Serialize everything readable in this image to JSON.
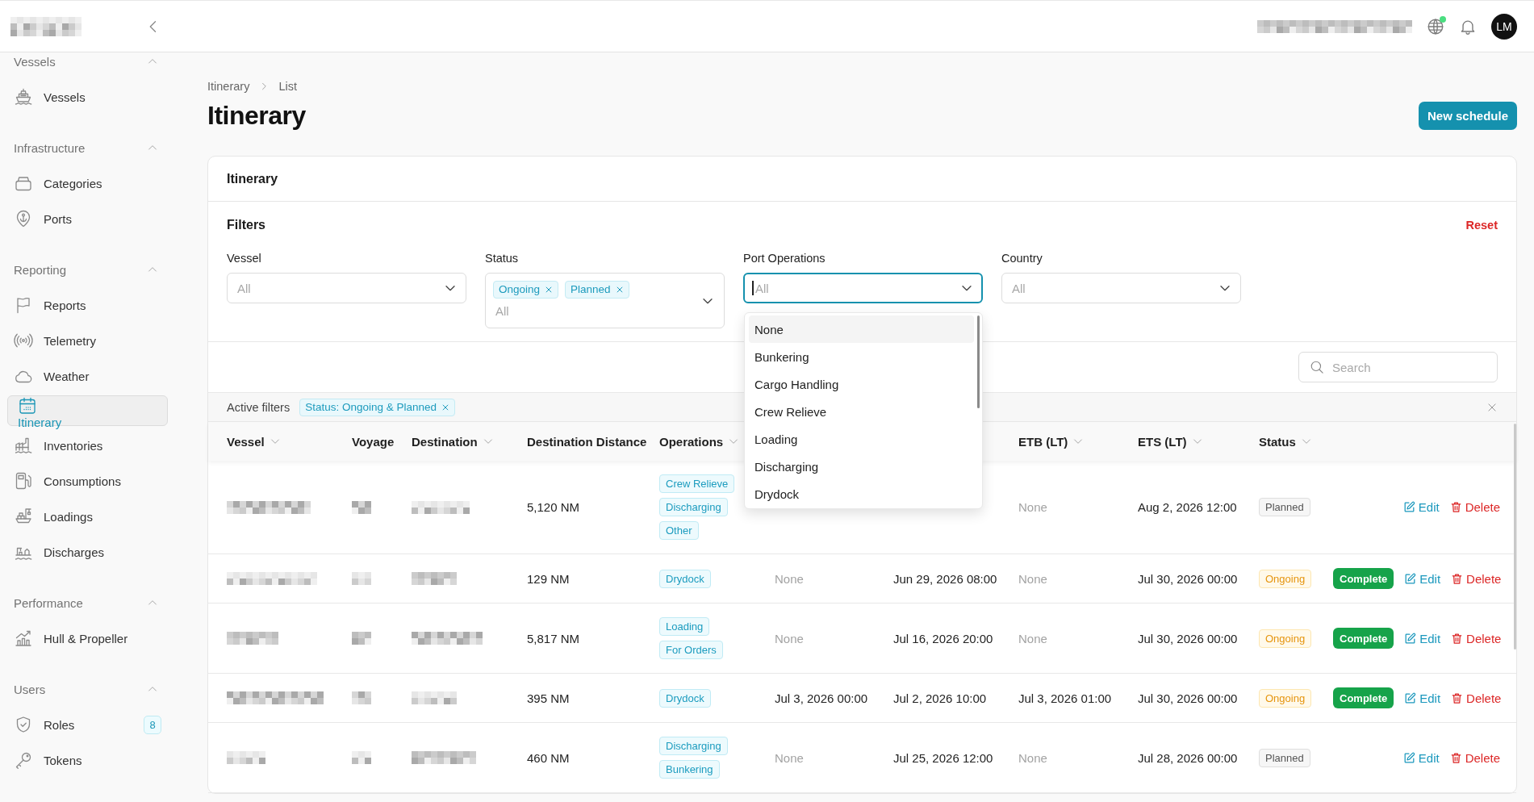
{
  "topbar": {
    "avatar": "LM"
  },
  "sidebar": {
    "groups": [
      {
        "title": "Vessels",
        "expanded": true,
        "items": [
          {
            "label": "Vessels",
            "selected": false
          }
        ]
      },
      {
        "title": "Infrastructure",
        "expanded": true,
        "items": [
          {
            "label": "Categories",
            "selected": false
          },
          {
            "label": "Ports",
            "selected": false
          }
        ]
      },
      {
        "title": "Reporting",
        "expanded": true,
        "items": [
          {
            "label": "Reports",
            "selected": false
          },
          {
            "label": "Telemetry",
            "selected": false
          },
          {
            "label": "Weather",
            "selected": false
          },
          {
            "label": "Itinerary",
            "selected": true
          },
          {
            "label": "Inventories",
            "selected": false
          },
          {
            "label": "Consumptions",
            "selected": false
          },
          {
            "label": "Loadings",
            "selected": false
          },
          {
            "label": "Discharges",
            "selected": false
          }
        ]
      },
      {
        "title": "Performance",
        "expanded": true,
        "items": [
          {
            "label": "Hull & Propeller",
            "selected": false
          }
        ]
      },
      {
        "title": "Users",
        "expanded": true,
        "items": [
          {
            "label": "Roles",
            "selected": false,
            "badge": "8"
          },
          {
            "label": "Tokens",
            "selected": false
          }
        ]
      }
    ]
  },
  "breadcrumb": [
    "Itinerary",
    "List"
  ],
  "page_title": "Itinerary",
  "new_button": "New schedule",
  "card": {
    "title": "Itinerary",
    "filters": {
      "title": "Filters",
      "reset": "Reset",
      "fields": [
        {
          "label": "Vessel",
          "placeholder": "All",
          "expanded": false
        },
        {
          "label": "Status",
          "placeholder": "All",
          "expanded": false,
          "chips": [
            "Ongoing",
            "Planned"
          ]
        },
        {
          "label": "Port Operations",
          "placeholder": "All",
          "expanded": true,
          "options": [
            {
              "label": "None",
              "highlighted": true
            },
            {
              "label": "Bunkering",
              "highlighted": false
            },
            {
              "label": "Cargo Handling",
              "highlighted": false
            },
            {
              "label": "Crew Relieve",
              "highlighted": false
            },
            {
              "label": "Loading",
              "highlighted": false
            },
            {
              "label": "Discharging",
              "highlighted": false
            },
            {
              "label": "Drydock",
              "highlighted": false
            }
          ]
        },
        {
          "label": "Country",
          "placeholder": "All",
          "expanded": false
        }
      ]
    },
    "search": {
      "placeholder": "Search"
    },
    "active_filters": {
      "label": "Active filters",
      "chips": [
        "Status: Ongoing & Planned"
      ]
    },
    "table": {
      "columns": [
        {
          "label": "Vessel",
          "sortable": true
        },
        {
          "label": "Voyage",
          "sortable": false
        },
        {
          "label": "Destination",
          "sortable": true
        },
        {
          "label": "Destination Distance",
          "sortable": false
        },
        {
          "label": "Operations",
          "sortable": true
        },
        null,
        null,
        {
          "label": "ETB (LT)",
          "sortable": true
        },
        {
          "label": "ETS (LT)",
          "sortable": true
        },
        {
          "label": "Status",
          "sortable": true
        }
      ],
      "rows": [
        {
          "distance": "5,120 NM",
          "operations": [
            "Crew Relieve",
            "Discharging",
            "Other"
          ],
          "etb": {
            "text": "None",
            "muted": true
          },
          "ets": {
            "text": "Aug 2, 2026 12:00",
            "muted": false
          },
          "status": {
            "label": "Planned",
            "kind": "planned"
          },
          "actions": [
            {
              "kind": "edit",
              "label": "Edit"
            },
            {
              "kind": "delete",
              "label": "Delete"
            }
          ]
        },
        {
          "distance": "129 NM",
          "operations": [
            "Drydock"
          ],
          "column_6": {
            "text": "None",
            "muted": true
          },
          "column_7": {
            "text": "Jun 29, 2026 08:00",
            "muted": false
          },
          "etb": {
            "text": "None",
            "muted": true
          },
          "ets": {
            "text": "Jul 30, 2026 00:00",
            "muted": false
          },
          "status": {
            "label": "Ongoing",
            "kind": "ongoing"
          },
          "actions": [
            {
              "kind": "complete",
              "label": "Complete"
            },
            {
              "kind": "edit",
              "label": "Edit"
            },
            {
              "kind": "delete",
              "label": "Delete"
            }
          ]
        },
        {
          "distance": "5,817 NM",
          "operations": [
            "Loading",
            "For Orders"
          ],
          "column_6": {
            "text": "None",
            "muted": true
          },
          "column_7": {
            "text": "Jul 16, 2026 20:00",
            "muted": false
          },
          "etb": {
            "text": "None",
            "muted": true
          },
          "ets": {
            "text": "Jul 30, 2026 00:00",
            "muted": false
          },
          "status": {
            "label": "Ongoing",
            "kind": "ongoing"
          },
          "actions": [
            {
              "kind": "complete",
              "label": "Complete"
            },
            {
              "kind": "edit",
              "label": "Edit"
            },
            {
              "kind": "delete",
              "label": "Delete"
            }
          ]
        },
        {
          "distance": "395 NM",
          "operations": [
            "Drydock"
          ],
          "column_6": {
            "text": "Jul 3, 2026 00:00",
            "muted": false
          },
          "column_7": {
            "text": "Jul 2, 2026 10:00",
            "muted": false
          },
          "etb": {
            "text": "Jul 3, 2026 01:00",
            "muted": false
          },
          "ets": {
            "text": "Jul 30, 2026 00:00",
            "muted": false
          },
          "status": {
            "label": "Ongoing",
            "kind": "ongoing"
          },
          "actions": [
            {
              "kind": "complete",
              "label": "Complete"
            },
            {
              "kind": "edit",
              "label": "Edit"
            },
            {
              "kind": "delete",
              "label": "Delete"
            }
          ]
        },
        {
          "distance": "460 NM",
          "operations": [
            "Discharging",
            "Bunkering"
          ],
          "column_6": {
            "text": "None",
            "muted": true
          },
          "column_7": {
            "text": "Jul 25, 2026 12:00",
            "muted": false
          },
          "etb": {
            "text": "None",
            "muted": true
          },
          "ets": {
            "text": "Jul 28, 2026 00:00",
            "muted": false
          },
          "status": {
            "label": "Planned",
            "kind": "planned"
          },
          "actions": [
            {
              "kind": "edit",
              "label": "Edit"
            },
            {
              "kind": "delete",
              "label": "Delete"
            }
          ]
        }
      ]
    }
  }
}
